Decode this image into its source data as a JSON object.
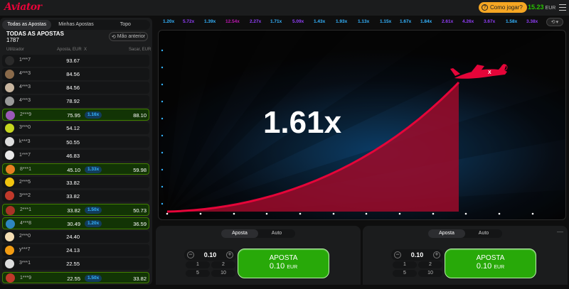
{
  "header": {
    "logo": "Aviator",
    "how_to_play": "Como jogar?",
    "balance": "15.23",
    "currency": "EUR"
  },
  "bets_panel": {
    "tabs": [
      "Todas as Apostas",
      "Minhas Apostas",
      "Topo"
    ],
    "title": "TODAS AS APOSTAS",
    "count": "1787",
    "prev_button": "Mão anterior",
    "columns": [
      "Utilizador",
      "Aposta, EUR",
      "X",
      "Sacar, EUR"
    ],
    "rows": [
      {
        "user": "1***7",
        "bet": "93.67",
        "mult": "",
        "cash": "",
        "win": false,
        "avatar": "#2a2a2a"
      },
      {
        "user": "4***3",
        "bet": "84.56",
        "mult": "",
        "cash": "",
        "win": false,
        "avatar": "#8a6a4a"
      },
      {
        "user": "4***3",
        "bet": "84.56",
        "mult": "",
        "cash": "",
        "win": false,
        "avatar": "#c9b6a0"
      },
      {
        "user": "4***3",
        "bet": "78.92",
        "mult": "",
        "cash": "",
        "win": false,
        "avatar": "#9a9a9a"
      },
      {
        "user": "2***9",
        "bet": "75.95",
        "mult": "1.16x",
        "cash": "88.10",
        "win": true,
        "avatar": "#9b59b6"
      },
      {
        "user": "3***0",
        "bet": "54.12",
        "mult": "",
        "cash": "",
        "win": false,
        "avatar": "#c6d61f"
      },
      {
        "user": "k***3",
        "bet": "50.55",
        "mult": "",
        "cash": "",
        "win": false,
        "avatar": "#ddd"
      },
      {
        "user": "1***7",
        "bet": "46.83",
        "mult": "",
        "cash": "",
        "win": false,
        "avatar": "#e8e8e8"
      },
      {
        "user": "8***1",
        "bet": "45.10",
        "mult": "1.33x",
        "cash": "59.98",
        "win": true,
        "avatar": "#e67e22"
      },
      {
        "user": "2***5",
        "bet": "33.82",
        "mult": "",
        "cash": "",
        "win": false,
        "avatar": "#f1c40f"
      },
      {
        "user": "3***2",
        "bet": "33.82",
        "mult": "",
        "cash": "",
        "win": false,
        "avatar": "#c0392b"
      },
      {
        "user": "2***1",
        "bet": "33.82",
        "mult": "1.50x",
        "cash": "50.73",
        "win": true,
        "avatar": "#a93226"
      },
      {
        "user": "4***8",
        "bet": "30.49",
        "mult": "1.20x",
        "cash": "36.59",
        "win": true,
        "avatar": "#2e86c1"
      },
      {
        "user": "2***0",
        "bet": "24.40",
        "mult": "",
        "cash": "",
        "win": false,
        "avatar": "#f5deb3"
      },
      {
        "user": "y***7",
        "bet": "24.13",
        "mult": "",
        "cash": "",
        "win": false,
        "avatar": "#f39c12"
      },
      {
        "user": "3***1",
        "bet": "22.55",
        "mult": "",
        "cash": "",
        "win": false,
        "avatar": "#ddd"
      },
      {
        "user": "1***9",
        "bet": "22.55",
        "mult": "1.50x",
        "cash": "33.82",
        "win": true,
        "avatar": "#c0392b"
      }
    ]
  },
  "history": [
    {
      "v": "1.20x",
      "c": "#34b4ff"
    },
    {
      "v": "5.72x",
      "c": "#913ef8"
    },
    {
      "v": "1.39x",
      "c": "#34b4ff"
    },
    {
      "v": "12.54x",
      "c": "#c017b4"
    },
    {
      "v": "2.27x",
      "c": "#913ef8"
    },
    {
      "v": "1.71x",
      "c": "#34b4ff"
    },
    {
      "v": "5.09x",
      "c": "#913ef8"
    },
    {
      "v": "1.43x",
      "c": "#34b4ff"
    },
    {
      "v": "1.93x",
      "c": "#34b4ff"
    },
    {
      "v": "1.13x",
      "c": "#34b4ff"
    },
    {
      "v": "1.15x",
      "c": "#34b4ff"
    },
    {
      "v": "1.67x",
      "c": "#34b4ff"
    },
    {
      "v": "1.84x",
      "c": "#34b4ff"
    },
    {
      "v": "2.61x",
      "c": "#913ef8"
    },
    {
      "v": "4.26x",
      "c": "#913ef8"
    },
    {
      "v": "3.67x",
      "c": "#913ef8"
    },
    {
      "v": "1.58x",
      "c": "#34b4ff"
    },
    {
      "v": "3.38x",
      "c": "#913ef8"
    }
  ],
  "game": {
    "multiplier": "1.61x",
    "plane_mark": "X"
  },
  "bet_panels": [
    {
      "tabs": [
        "Aposta",
        "Auto"
      ],
      "amount": "0.10",
      "quick": [
        "1",
        "2",
        "5",
        "10"
      ],
      "button_label": "APOSTA",
      "button_value": "0.10",
      "button_currency": "EUR",
      "minus": "−",
      "plus": "+"
    },
    {
      "tabs": [
        "Aposta",
        "Auto"
      ],
      "amount": "0.10",
      "quick": [
        "1",
        "2",
        "5",
        "10"
      ],
      "button_label": "APOSTA",
      "button_value": "0.10",
      "button_currency": "EUR",
      "minus": "−",
      "plus": "+",
      "more": "—"
    }
  ]
}
